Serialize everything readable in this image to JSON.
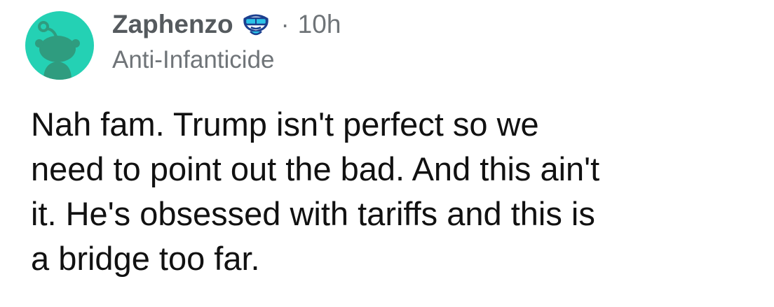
{
  "comment": {
    "username": "Zaphenzo",
    "timestamp": "10h",
    "separator": "·",
    "user_flair": "Anti-Infanticide",
    "body_lines": [
      "Nah fam. Trump isn't perfect so we",
      "need to point out the bad. And this ain't",
      "it. He's obsessed with tariffs and this is",
      "a bridge too far."
    ],
    "avatar_icon": "snoo-avatar-icon",
    "flair_icon": "snoo-sunglasses-icon",
    "colors": {
      "avatar_background": "#24d1b4",
      "avatar_figure": "#2f9c7f",
      "username": "#555a5e",
      "meta": "#6f7478",
      "body": "#111111"
    }
  }
}
